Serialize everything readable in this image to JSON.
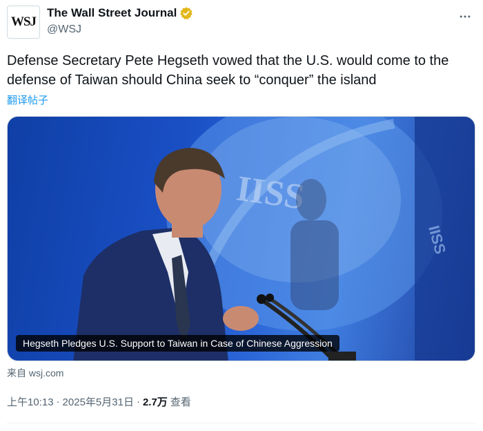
{
  "account": {
    "avatar_text": "WSJ",
    "display_name": "The Wall Street Journal",
    "handle": "@WSJ",
    "verified_color": "#e2b719"
  },
  "tweet": {
    "text": "Defense Secretary Pete Hegseth vowed that the U.S. would come to the defense of Taiwan should China seek to “conquer” the island",
    "translate_label": "翻译帖子"
  },
  "media": {
    "caption": "Hegseth Pledges U.S. Support to Taiwan in Case of Chinese Aggression",
    "backdrop_text": "IISS"
  },
  "link_source": "来自 wsj.com",
  "meta": {
    "time": "上午10:13",
    "sep1": "·",
    "date": "2025年5月31日",
    "sep2": "·",
    "views_count": "2.7万",
    "views_label": "查看"
  },
  "colors": {
    "link": "#1d9bf0",
    "muted": "#536471"
  },
  "icons": {
    "more": "more-icon",
    "verified": "verified-badge-icon"
  }
}
